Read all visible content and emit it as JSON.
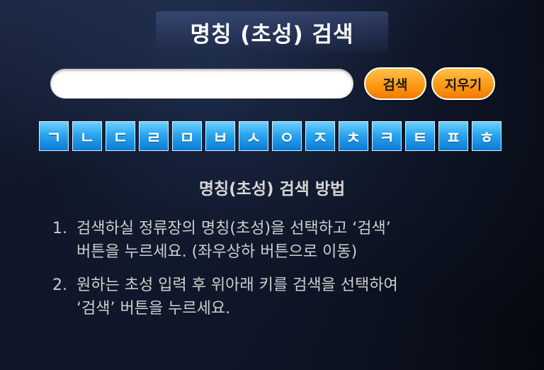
{
  "header": {
    "title": "명칭 (초성) 검색"
  },
  "search": {
    "value": "",
    "placeholder": "",
    "search_label": "검색",
    "clear_label": "지우기"
  },
  "keypad": {
    "keys": [
      "ㄱ",
      "ㄴ",
      "ㄷ",
      "ㄹ",
      "ㅁ",
      "ㅂ",
      "ㅅ",
      "ㅇ",
      "ㅈ",
      "ㅊ",
      "ㅋ",
      "ㅌ",
      "ㅍ",
      "ㅎ"
    ]
  },
  "help": {
    "title": "명칭(초성) 검색 방법",
    "items": [
      {
        "num": "1.",
        "line1": "검색하실 정류장의 명칭(초성)을 선택하고 ‘검색’",
        "line2": "버튼을 누르세요. (좌우상하 버튼으로 이동)"
      },
      {
        "num": "2.",
        "line1": "원하는 초성 입력 후 위아래 키를 검색을 선택하여",
        "line2": "‘검색’ 버튼을 누르세요."
      }
    ]
  },
  "colors": {
    "accent_orange": "#ff9a14",
    "key_blue": "#2ba6ee",
    "background": "#0f1628"
  }
}
